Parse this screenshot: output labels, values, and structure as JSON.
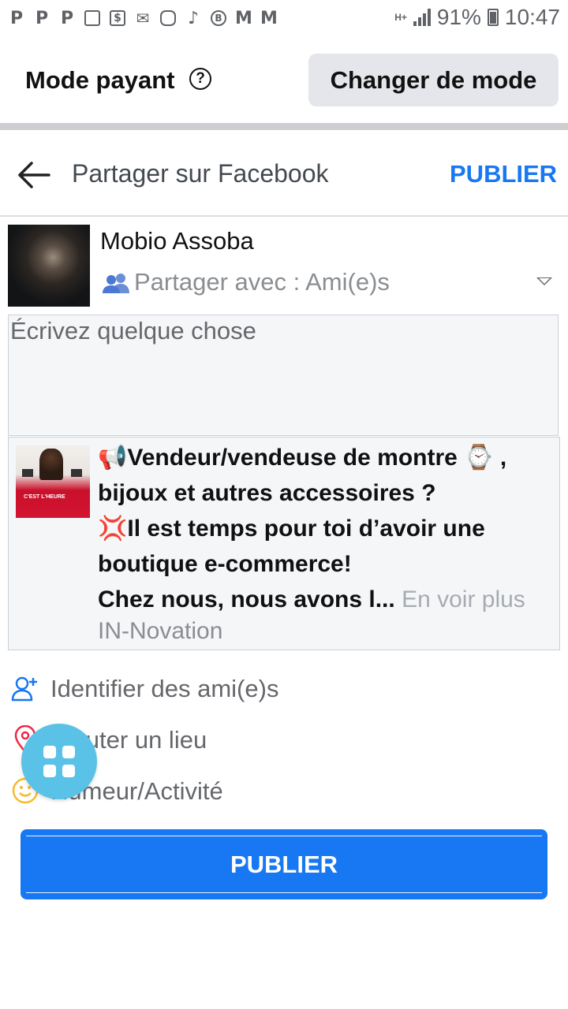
{
  "status_bar": {
    "notification_icons": [
      "p-icon",
      "p-icon",
      "p-icon",
      "image-icon",
      "dollar-icon",
      "mail-icon",
      "instagram-icon",
      "tiktok-icon",
      "b-icon",
      "gmail-icon",
      "gmail-icon"
    ],
    "network_label": "H+",
    "battery": "91%",
    "time": "10:47"
  },
  "mode_bar": {
    "title": "Mode payant",
    "help_glyph": "?",
    "change_button": "Changer de mode"
  },
  "share_header": {
    "title": "Partager sur Facebook",
    "publish": "PUBLIER"
  },
  "user": {
    "name": "Mobio Assoba",
    "audience": "Partager avec : Ami(e)s"
  },
  "compose": {
    "placeholder": "Écrivez quelque chose",
    "value": ""
  },
  "shared_post": {
    "line1_emoji": "📢",
    "line1_text": "Vendeur/vendeuse de montre ",
    "line1_emoji2": "⌚",
    "line1_tail": " ,",
    "line2_text": "bijoux et autres accessoires ?",
    "line3_emoji": "💢",
    "line3_text": "Il est temps pour toi d’avoir une",
    "line4_text": "boutique e-commerce!",
    "line5_text": "Chez nous, nous avons l...",
    "see_more": "En voir plus",
    "source": "IN-Novation",
    "thumb_caption": "C'EST L'HEURE"
  },
  "actions": {
    "tag_friends": "Identifier des ami(e)s",
    "add_location": "Ajouter un lieu",
    "mood": "Humeur/Activité"
  },
  "publish_button": "PUBLIER",
  "colors": {
    "brand_blue": "#1877f2",
    "fab": "#5bc2e7",
    "tag_icon": "#1877f2",
    "location_icon": "#f02849",
    "mood_icon": "#f7b928"
  }
}
